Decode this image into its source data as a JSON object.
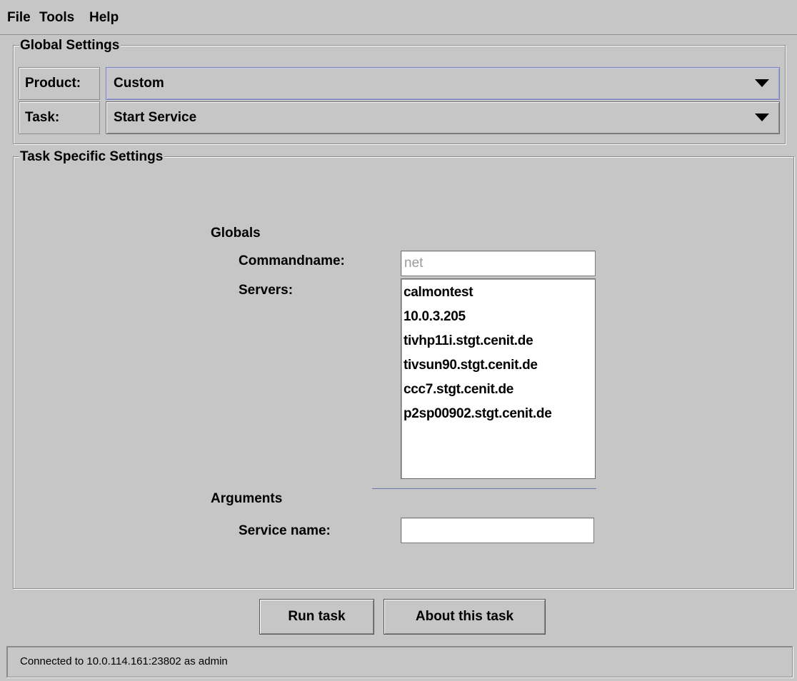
{
  "menu": {
    "items": [
      "File",
      "Tools",
      "Help"
    ]
  },
  "global_settings": {
    "title": "Global Settings",
    "product_label": "Product:",
    "product_value": "Custom",
    "task_label": "Task:",
    "task_value": "Start Service"
  },
  "task_settings": {
    "title": "Task Specific Settings",
    "globals_heading": "Globals",
    "commandname_label": "Commandname:",
    "commandname_value": "net",
    "servers_label": "Servers:",
    "servers": [
      "calmontest",
      "10.0.3.205",
      "tivhp11i.stgt.cenit.de",
      "tivsun90.stgt.cenit.de",
      "ccc7.stgt.cenit.de",
      "p2sp00902.stgt.cenit.de"
    ],
    "arguments_heading": "Arguments",
    "service_name_label": "Service name:",
    "service_name_value": ""
  },
  "buttons": {
    "run_task": "Run task",
    "about_task": "About this task"
  },
  "status": {
    "text": "Connected to 10.0.114.161:23802 as admin"
  },
  "colors": {
    "background": "#c6c6c6",
    "focus_border": "#7a80b8",
    "separator": "#6f75b0"
  }
}
